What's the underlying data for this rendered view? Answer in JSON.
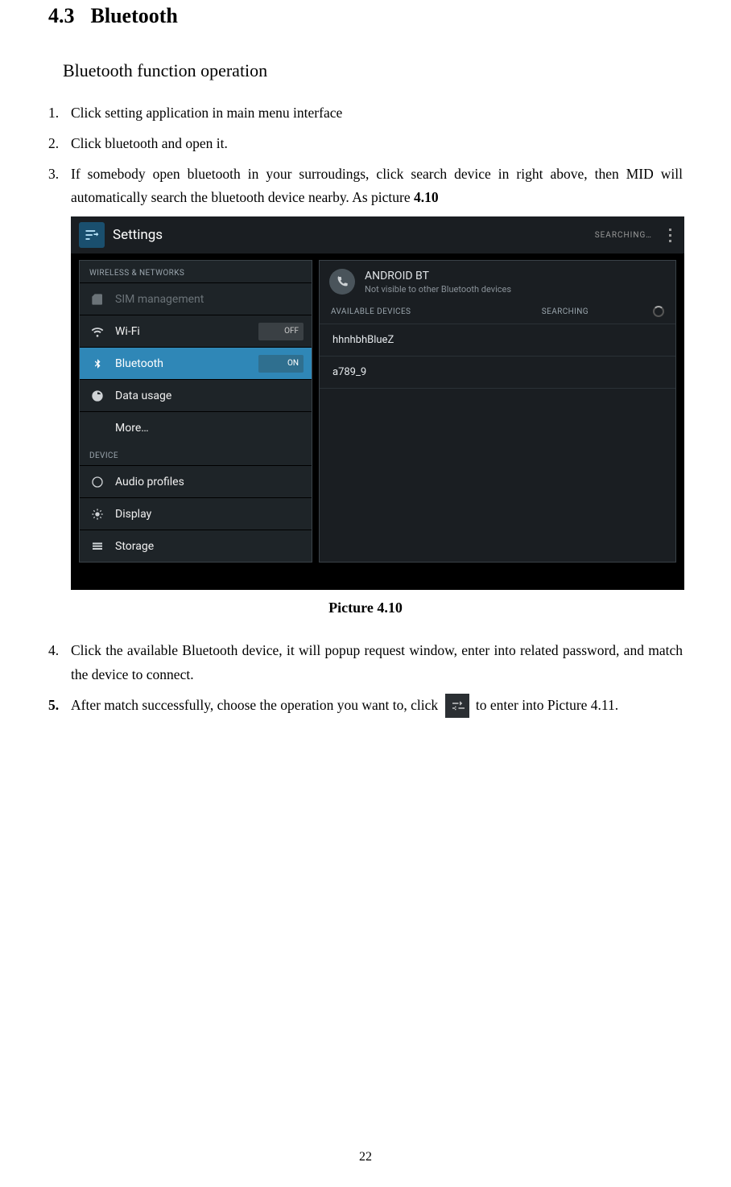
{
  "heading_num": "4.3",
  "heading_title": "Bluetooth",
  "subheading": "Bluetooth function operation",
  "steps": {
    "s1": "Click setting application in main menu interface",
    "s2": "Click bluetooth and open it.",
    "s3_a": "If somebody open bluetooth in your surroudings, click search device in right above, then MID will automatically search the bluetooth device nearby. As picture ",
    "s3_b": "4.10",
    "s4": "Click the available Bluetooth device, it will popup request window, enter into related password, and match the device to connect.",
    "s5_a": "After match successfully, choose the operation you want to, click ",
    "s5_b": " to enter into Picture 4.11."
  },
  "markers": {
    "m1": "1.",
    "m2": "2.",
    "m3": "3.",
    "m4": "4.",
    "m5": "5."
  },
  "caption": "Picture 4.10",
  "page_number": "22",
  "screenshot": {
    "title": "Settings",
    "searching_hdr": "SEARCHING…",
    "cat_wireless": "WIRELESS & NETWORKS",
    "cat_device": "DEVICE",
    "sim": "SIM management",
    "wifi": "Wi-Fi",
    "wifi_state": "OFF",
    "bluetooth": "Bluetooth",
    "bluetooth_state": "ON",
    "data_usage": "Data usage",
    "more": "More…",
    "audio": "Audio profiles",
    "display": "Display",
    "storage": "Storage",
    "bt_name": "ANDROID BT",
    "bt_sub": "Not visible to other Bluetooth devices",
    "available": "AVAILABLE DEVICES",
    "searching": "SEARCHING",
    "dev1": "hhnhbhBlueZ",
    "dev2": "a789_9"
  }
}
